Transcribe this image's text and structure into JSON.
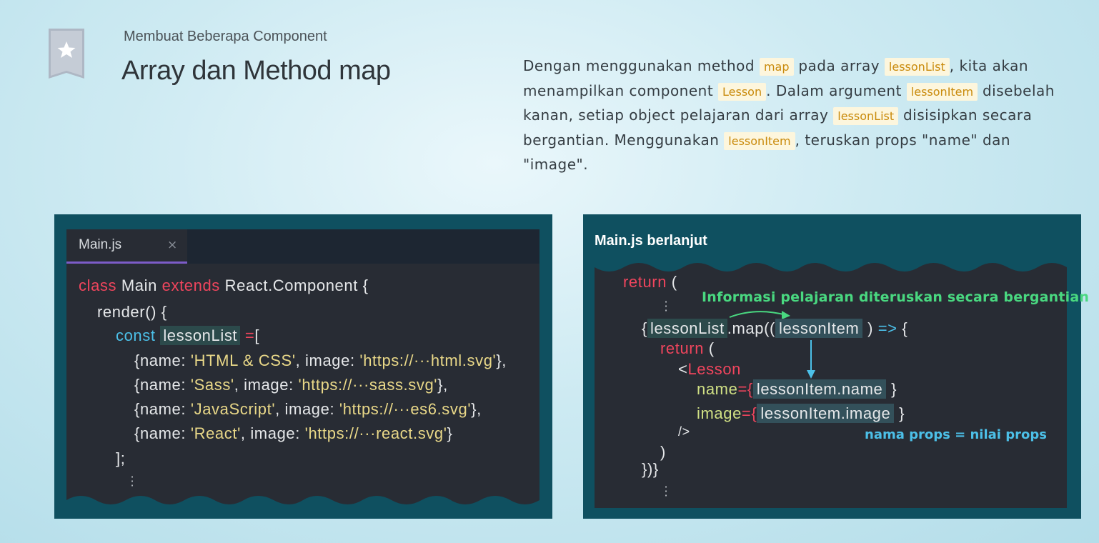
{
  "header": {
    "subtitle": "Membuat Beberapa Component",
    "title": "Array dan Method map"
  },
  "description": {
    "t1": "Dengan menggunakan method ",
    "c1": "map",
    "t2": " pada array ",
    "c2": "lessonList",
    "t3": ", kita akan menampilkan component ",
    "c3": "Lesson",
    "t4": ". Dalam argument ",
    "c4": "lessonItem",
    "t5": " disebelah kanan, setiap object pelajaran dari array ",
    "c5": "lessonList",
    "t6": " disisipkan secara bergantian. Menggunakan ",
    "c6": "lessonItem",
    "t7": ", teruskan props \"name\" dan \"image\"."
  },
  "left_panel": {
    "tab_label": "Main.js",
    "tab_close": "×",
    "line1": {
      "kw1": "class",
      "main": " Main ",
      "kw2": "extends",
      "rest": " React.Component {"
    },
    "line2": "render() {",
    "line3": {
      "const": "const",
      "var": "lessonList",
      "eq": " =",
      "br": "["
    },
    "items": [
      {
        "open": "{name: ",
        "name": "'HTML & CSS'",
        "mid": ", image: ",
        "url": "'https://···html.svg'",
        "close": "},"
      },
      {
        "open": "{name: ",
        "name": "'Sass'",
        "mid": ", image: ",
        "url": "'https://···sass.svg'",
        "close": "},"
      },
      {
        "open": "{name: ",
        "name": "'JavaScript'",
        "mid": ", image: ",
        "url": "'https://···es6.svg'",
        "close": "},"
      },
      {
        "open": "{name: ",
        "name": "'React'",
        "mid": ", image: ",
        "url": "'https://···react.svg'",
        "close": "}"
      }
    ],
    "line_end": "];"
  },
  "right_panel": {
    "title": "Main.js berlanjut",
    "return1": "return",
    "paren_open": " (",
    "annotation_green": "Informasi pelajaran diteruskan secara bergantian",
    "map_open": "{",
    "map_var": "lessonList",
    "map_call": ".map((",
    "map_param": "lessonItem",
    "map_arrow_close": " )",
    "map_arrow": " =>",
    "map_brace": " {",
    "return2": "return",
    "paren2": " (",
    "lt": "<",
    "component": "Lesson",
    "prop1": "name",
    "prop1_eq": "={",
    "prop1_val": "lessonItem.name",
    "prop1_close": "}",
    "prop2": "image",
    "prop2_eq": "={",
    "prop2_val": "lessonItem.image",
    "prop2_close": "}",
    "selfclose": "/>",
    "close_paren": ")",
    "close_map": "})}",
    "annotation_blue": "nama props = nilai props"
  }
}
